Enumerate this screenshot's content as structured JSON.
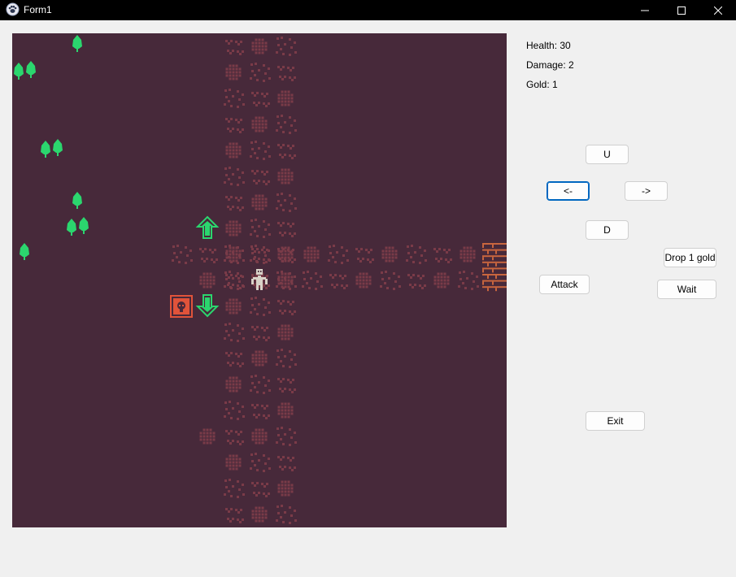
{
  "window": {
    "title": "Form1",
    "icon": "paw-icon",
    "controls": [
      "minimize-icon",
      "maximize-icon",
      "close-icon"
    ]
  },
  "map": {
    "background": "#47293a",
    "floor_color": "#7a3b48",
    "tree_color": "#2bd66e",
    "arrow_color": "#2bd66e",
    "enemy_color": "#e0533a",
    "player_color": "#d9d2c8",
    "stairs_color": "#c8653e",
    "icons": [
      "tree-icon",
      "up-arrow-tile-icon",
      "down-arrow-tile-icon",
      "enemy-tile-icon",
      "player-sprite-icon",
      "stairs-icon"
    ]
  },
  "stats": {
    "health": "Health: 30",
    "damage": "Damage: 2",
    "gold": "Gold: 1"
  },
  "buttons": {
    "up": "U",
    "left": "<-",
    "right": "->",
    "down": "D",
    "drop_gold": "Drop 1 gold",
    "attack": "Attack",
    "wait": "Wait",
    "exit": "Exit"
  }
}
